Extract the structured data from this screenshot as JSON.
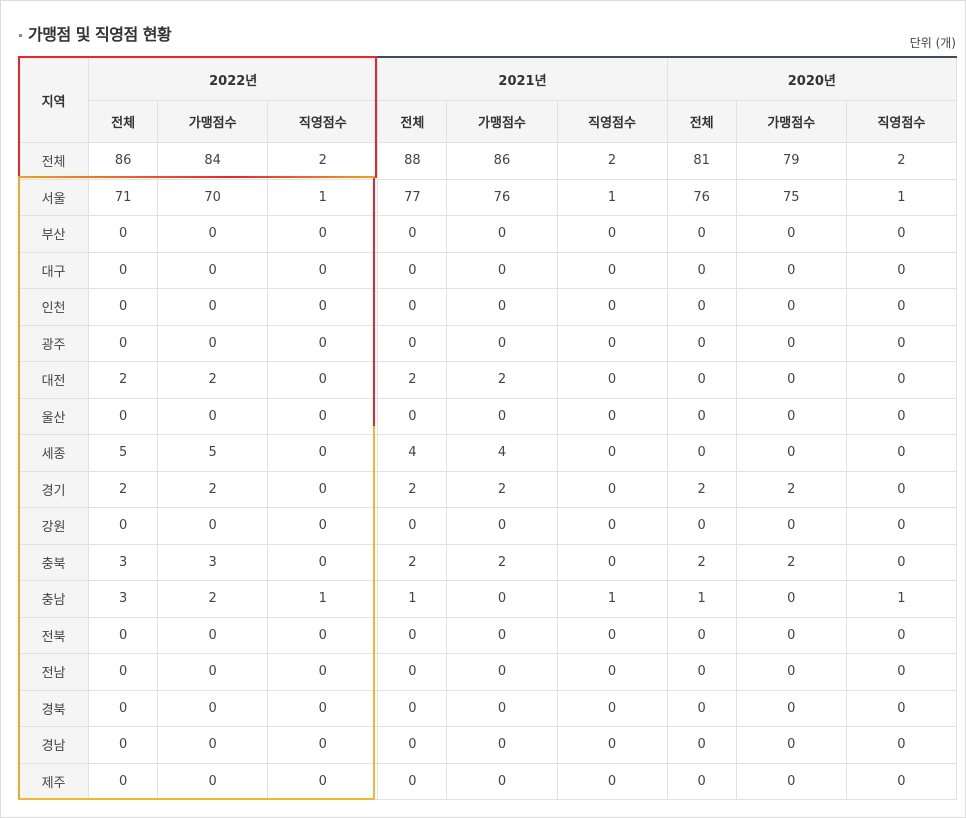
{
  "title": "가맹점 및 직영점 현황",
  "unit": "단위 (개)",
  "header": {
    "region": "지역",
    "years": [
      "2022년",
      "2021년",
      "2020년"
    ],
    "sub": [
      "전체",
      "가맹점수",
      "직영점수"
    ]
  },
  "rows": [
    {
      "region": "전체",
      "values": [
        "86",
        "84",
        "2",
        "88",
        "86",
        "2",
        "81",
        "79",
        "2"
      ]
    },
    {
      "region": "서울",
      "values": [
        "71",
        "70",
        "1",
        "77",
        "76",
        "1",
        "76",
        "75",
        "1"
      ]
    },
    {
      "region": "부산",
      "values": [
        "0",
        "0",
        "0",
        "0",
        "0",
        "0",
        "0",
        "0",
        "0"
      ]
    },
    {
      "region": "대구",
      "values": [
        "0",
        "0",
        "0",
        "0",
        "0",
        "0",
        "0",
        "0",
        "0"
      ]
    },
    {
      "region": "인천",
      "values": [
        "0",
        "0",
        "0",
        "0",
        "0",
        "0",
        "0",
        "0",
        "0"
      ]
    },
    {
      "region": "광주",
      "values": [
        "0",
        "0",
        "0",
        "0",
        "0",
        "0",
        "0",
        "0",
        "0"
      ]
    },
    {
      "region": "대전",
      "values": [
        "2",
        "2",
        "0",
        "2",
        "2",
        "0",
        "0",
        "0",
        "0"
      ]
    },
    {
      "region": "울산",
      "values": [
        "0",
        "0",
        "0",
        "0",
        "0",
        "0",
        "0",
        "0",
        "0"
      ]
    },
    {
      "region": "세종",
      "values": [
        "5",
        "5",
        "0",
        "4",
        "4",
        "0",
        "0",
        "0",
        "0"
      ]
    },
    {
      "region": "경기",
      "values": [
        "2",
        "2",
        "0",
        "2",
        "2",
        "0",
        "2",
        "2",
        "0"
      ]
    },
    {
      "region": "강원",
      "values": [
        "0",
        "0",
        "0",
        "0",
        "0",
        "0",
        "0",
        "0",
        "0"
      ]
    },
    {
      "region": "충북",
      "values": [
        "3",
        "3",
        "0",
        "2",
        "2",
        "0",
        "2",
        "2",
        "0"
      ]
    },
    {
      "region": "충남",
      "values": [
        "3",
        "2",
        "1",
        "1",
        "0",
        "1",
        "1",
        "0",
        "1"
      ]
    },
    {
      "region": "전북",
      "values": [
        "0",
        "0",
        "0",
        "0",
        "0",
        "0",
        "0",
        "0",
        "0"
      ]
    },
    {
      "region": "전남",
      "values": [
        "0",
        "0",
        "0",
        "0",
        "0",
        "0",
        "0",
        "0",
        "0"
      ]
    },
    {
      "region": "경북",
      "values": [
        "0",
        "0",
        "0",
        "0",
        "0",
        "0",
        "0",
        "0",
        "0"
      ]
    },
    {
      "region": "경남",
      "values": [
        "0",
        "0",
        "0",
        "0",
        "0",
        "0",
        "0",
        "0",
        "0"
      ]
    },
    {
      "region": "제주",
      "values": [
        "0",
        "0",
        "0",
        "0",
        "0",
        "0",
        "0",
        "0",
        "0"
      ]
    }
  ],
  "colors": {
    "highlight_red": "#e8262b",
    "highlight_yellow": "#f0b830",
    "header_bg": "#f5f5f5",
    "top_rule": "#3d4b5c"
  }
}
